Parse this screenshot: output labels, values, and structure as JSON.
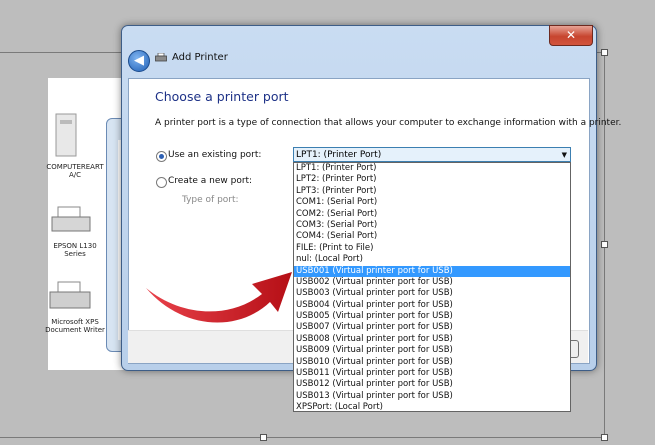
{
  "dialog": {
    "title": "Add Printer",
    "close_glyph": "✕",
    "back_glyph": "◀",
    "heading": "Choose a printer port",
    "description": "A printer port is a type of connection that allows your computer to exchange information with a printer."
  },
  "options": {
    "existing_port_label": "Use an existing port:",
    "new_port_label": "Create a new port:",
    "type_of_port_label": "Type of port:"
  },
  "port_select": {
    "value": "LPT1: (Printer Port)",
    "arrow_glyph": "▼"
  },
  "port_list": {
    "selected_index": 11,
    "items": [
      "LPT1: (Printer Port)",
      "LPT2: (Printer Port)",
      "LPT3: (Printer Port)",
      "COM1: (Serial Port)",
      "COM2: (Serial Port)",
      "COM3: (Serial Port)",
      "COM4: (Serial Port)",
      "FILE: (Print to File)",
      "nul: (Local Port)",
      "USB001 (Virtual printer port for USB)",
      "USB002 (Virtual printer port for USB)",
      "USB003 (Virtual printer port for USB)",
      "USB004 (Virtual printer port for USB)",
      "USB005 (Virtual printer port for USB)",
      "USB007 (Virtual printer port for USB)",
      "USB008 (Virtual printer port for USB)",
      "USB009 (Virtual printer port for USB)",
      "USB010 (Virtual printer port for USB)",
      "USB011 (Virtual printer port for USB)",
      "USB012 (Virtual printer port for USB)",
      "USB013 (Virtual printer port for USB)",
      "XPSPort: (Local Port)"
    ]
  },
  "background_devices": [
    {
      "label": "COMPUTEREART A/C",
      "icon": "printer-icon"
    },
    {
      "label": "EPSON L130 Series",
      "icon": "printer-icon"
    },
    {
      "label": "Microsoft XPS Document Writer",
      "icon": "printer-icon"
    }
  ],
  "colors": {
    "selection": "#3399ff",
    "heading": "#1e3287",
    "arrow": "#d1141b"
  }
}
